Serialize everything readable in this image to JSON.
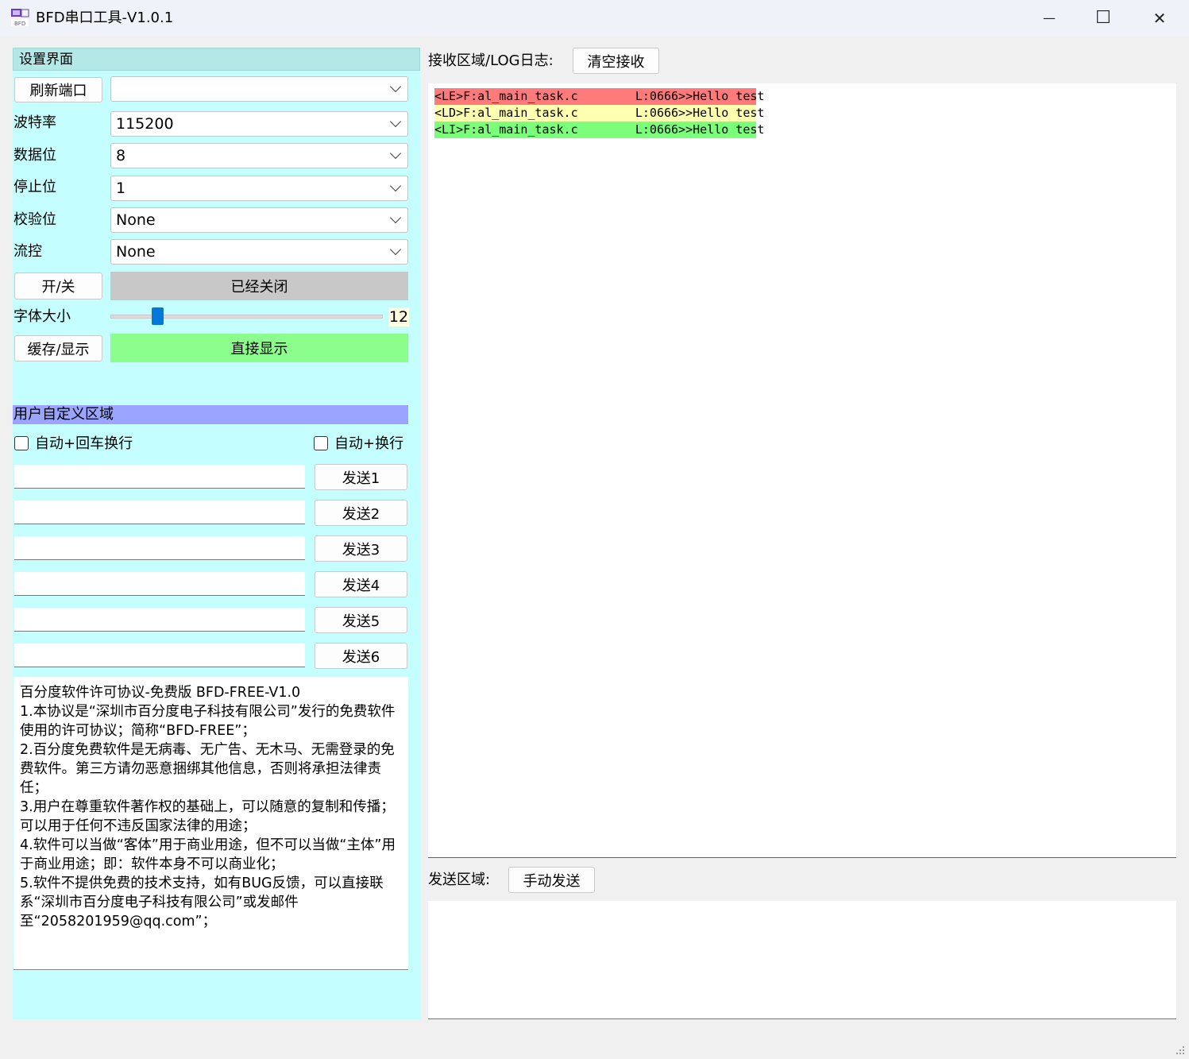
{
  "window": {
    "title": "BFD串口工具-V1.0.1",
    "minimize": "—",
    "maximize": "☐",
    "close": "✕"
  },
  "settings": {
    "header": "设置界面",
    "refresh_port_button": "刷新端口",
    "port_value": "",
    "baud_label": "波特率",
    "baud_value": "115200",
    "data_bits_label": "数据位",
    "data_bits_value": "8",
    "stop_bits_label": "停止位",
    "stop_bits_value": "1",
    "parity_label": "校验位",
    "parity_value": "None",
    "flow_label": "流控",
    "flow_value": "None",
    "toggle_button": "开/关",
    "status_text": "已经关闭",
    "font_size_label": "字体大小",
    "font_size_value": "12",
    "cache_button": "缓存/显示",
    "display_mode_text": "直接显示"
  },
  "user_area": {
    "header": "用户自定义区域",
    "auto_crlf_label": "自动+回车换行",
    "auto_lf_label": "自动+换行",
    "send_buttons": [
      "发送1",
      "发送2",
      "发送3",
      "发送4",
      "发送5",
      "发送6"
    ]
  },
  "license": {
    "text": "百分度软件许可协议-免费版 BFD-FREE-V1.0\n1.本协议是“深圳市百分度电子科技有限公司”发行的免费软件使用的许可协议；简称“BFD-FREE”；\n2.百分度免费软件是无病毒、无广告、无木马、无需登录的免费软件。第三方请勿恶意捆绑其他信息，否则将承担法律责任；\n3.用户在尊重软件著作权的基础上，可以随意的复制和传播；可以用于任何不违反国家法律的用途；\n4.软件可以当做“客体”用于商业用途，但不可以当做“主体”用于商业用途；即：软件本身不可以商业化；\n5.软件不提供免费的技术支持，如有BUG反馈，可以直接联系“深圳市百分度电子科技有限公司”或发邮件至“2058201959@qq.com”；"
  },
  "receive": {
    "label": "接收区域/LOG日志:",
    "clear_button": "清空接收",
    "log_lines": [
      {
        "text": "<LE>F:al_main_task.c        L:0666>>Hello test",
        "color": "#ff7b7b"
      },
      {
        "text": "<LD>F:al_main_task.c        L:0666>>Hello test",
        "color": "#ffffb0"
      },
      {
        "text": "<LI>F:al_main_task.c        L:0666>>Hello test",
        "color": "#7bff7b"
      }
    ]
  },
  "send": {
    "label": "发送区域:",
    "manual_send_button": "手动发送"
  }
}
